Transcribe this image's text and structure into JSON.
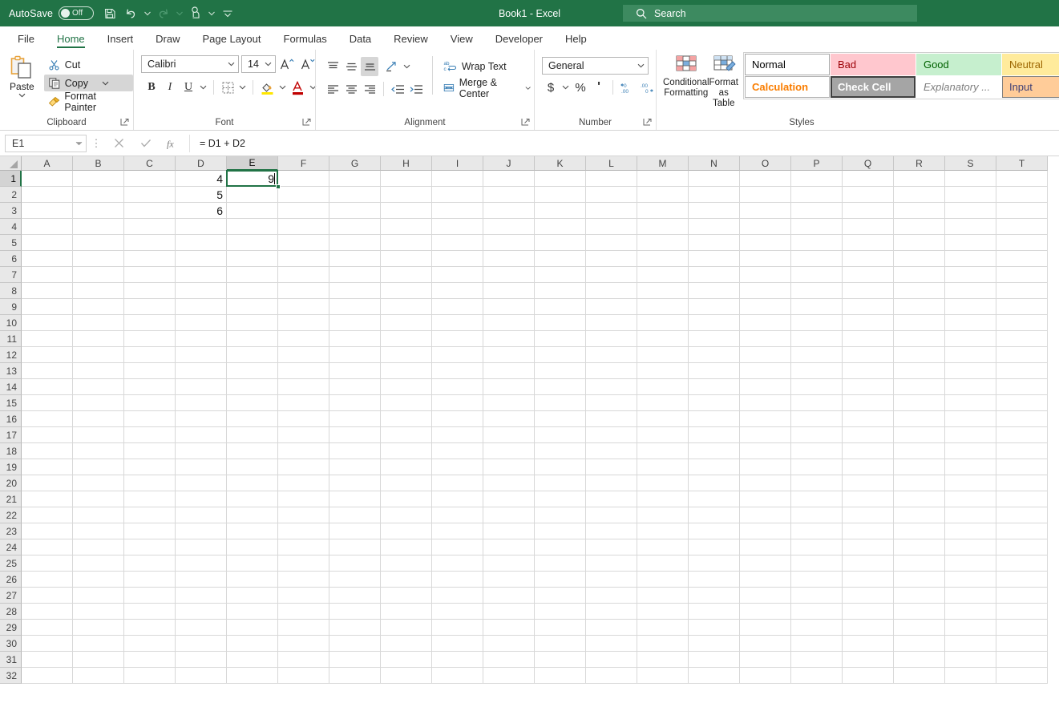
{
  "titlebar": {
    "autosave_label": "AutoSave",
    "autosave_state": "Off",
    "document_title": "Book1  -  Excel",
    "search_placeholder": "Search",
    "qat_icons": [
      "save-icon",
      "undo-icon",
      "redo-icon",
      "touch-mode-icon",
      "customize-qat-icon"
    ]
  },
  "tabs": [
    {
      "label": "File",
      "active": false
    },
    {
      "label": "Home",
      "active": true
    },
    {
      "label": "Insert",
      "active": false
    },
    {
      "label": "Draw",
      "active": false
    },
    {
      "label": "Page Layout",
      "active": false
    },
    {
      "label": "Formulas",
      "active": false
    },
    {
      "label": "Data",
      "active": false
    },
    {
      "label": "Review",
      "active": false
    },
    {
      "label": "View",
      "active": false
    },
    {
      "label": "Developer",
      "active": false
    },
    {
      "label": "Help",
      "active": false
    }
  ],
  "ribbon": {
    "clipboard": {
      "group_label": "Clipboard",
      "paste_label": "Paste",
      "cut_label": "Cut",
      "copy_label": "Copy",
      "format_painter_label": "Format Painter"
    },
    "font": {
      "group_label": "Font",
      "font_name": "Calibri",
      "font_size": "14",
      "bold_label": "B",
      "italic_label": "I",
      "underline_label": "U"
    },
    "alignment": {
      "group_label": "Alignment",
      "wrap_text_label": "Wrap Text",
      "merge_center_label": "Merge & Center"
    },
    "number": {
      "group_label": "Number",
      "format": "General",
      "currency_label": "$",
      "percent_label": "%",
      "comma_label": "'"
    },
    "styles": {
      "group_label": "Styles",
      "conditional_formatting_label": "Conditional Formatting",
      "format_as_table_label": "Format as Table",
      "cells": [
        {
          "label": "Normal",
          "bg": "#ffffff",
          "fg": "#000000",
          "border": "#a6a6a6",
          "italic": false,
          "bold": false
        },
        {
          "label": "Bad",
          "bg": "#ffc7ce",
          "fg": "#9c0006",
          "border": "transparent",
          "italic": false,
          "bold": false
        },
        {
          "label": "Good",
          "bg": "#c6efce",
          "fg": "#006100",
          "border": "transparent",
          "italic": false,
          "bold": false
        },
        {
          "label": "Neutral",
          "bg": "#ffeb9c",
          "fg": "#9c6500",
          "border": "transparent",
          "italic": false,
          "bold": false
        },
        {
          "label": "Calculation",
          "bg": "#ffffff",
          "fg": "#fa7d00",
          "border": "#b2b2b2",
          "italic": false,
          "bold": true
        },
        {
          "label": "Check Cell",
          "bg": "#a5a5a5",
          "fg": "#ffffff",
          "border": "#3f3f3f",
          "italic": false,
          "bold": true
        },
        {
          "label": "Explanatory ...",
          "bg": "#ffffff",
          "fg": "#7f7f7f",
          "border": "transparent",
          "italic": true,
          "bold": false
        },
        {
          "label": "Input",
          "bg": "#ffcc99",
          "fg": "#3f3f76",
          "border": "#7f7f7f",
          "italic": false,
          "bold": false
        }
      ]
    }
  },
  "formula_bar": {
    "name_box": "E1",
    "formula": "= D1 + D2",
    "cancel_icon": "cancel-icon",
    "enter_icon": "check-icon",
    "function_icon": "fx-icon"
  },
  "grid": {
    "columns": [
      "A",
      "B",
      "C",
      "D",
      "E",
      "F",
      "G",
      "H",
      "I",
      "J",
      "K",
      "L",
      "M",
      "N",
      "O",
      "P",
      "Q",
      "R",
      "S",
      "T"
    ],
    "rows": [
      1,
      2,
      3,
      4,
      5,
      6,
      7,
      8,
      9,
      10,
      11,
      12,
      13,
      14,
      15,
      16,
      17,
      18,
      19,
      20,
      21,
      22,
      23,
      24,
      25,
      26,
      27,
      28,
      29,
      30,
      31,
      32
    ],
    "selected_cell": "E1",
    "selected_column": "E",
    "selected_row": 1,
    "cell_values": {
      "D1": "4",
      "D2": "5",
      "D3": "6",
      "E1": "9"
    }
  },
  "colors": {
    "brand_green": "#217346",
    "titlebar_bg": "#217346",
    "search_bg": "#3d8a60",
    "header_bg": "#e8e8e8",
    "selected_header_bg": "#d3d3d3",
    "gridline": "#d8d8d8"
  }
}
